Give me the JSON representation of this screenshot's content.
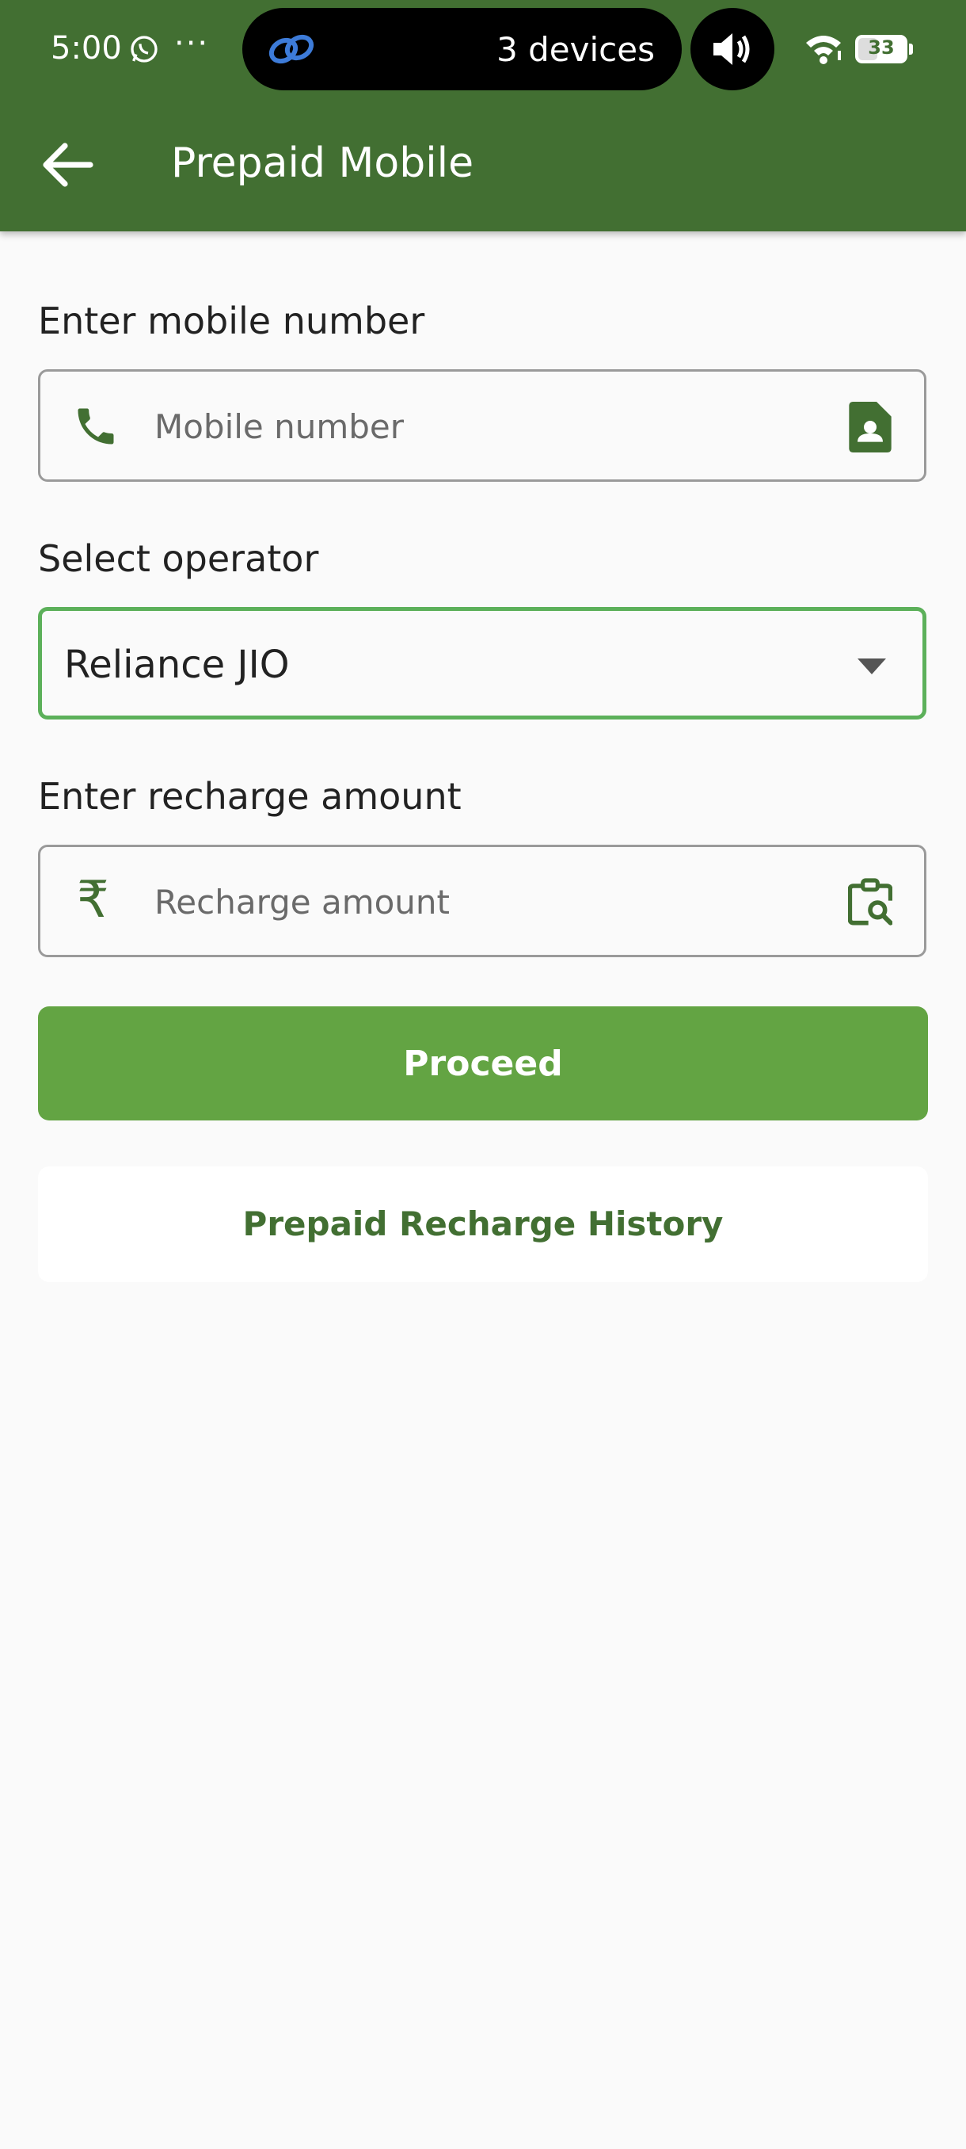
{
  "status_bar": {
    "time": "5:00",
    "dots": "···",
    "cast_label": "3 devices",
    "battery": "33"
  },
  "app_bar": {
    "title": "Prepaid Mobile",
    "color": "#426f32"
  },
  "form": {
    "mobile_label": "Enter mobile number",
    "mobile_placeholder": "Mobile number",
    "operator_label": "Select operator",
    "operator_value": "Reliance JIO",
    "amount_label": "Enter recharge amount",
    "amount_prefix": "₹",
    "amount_placeholder": "Recharge amount"
  },
  "buttons": {
    "proceed": "Proceed",
    "history": "Prepaid Recharge History",
    "proceed_color": "#63a443"
  },
  "icons": {
    "back": "arrow-left-icon",
    "phone": "phone-icon",
    "contact": "contact-card-icon",
    "dropdown": "caret-down-icon",
    "plans": "clipboard-search-icon"
  }
}
